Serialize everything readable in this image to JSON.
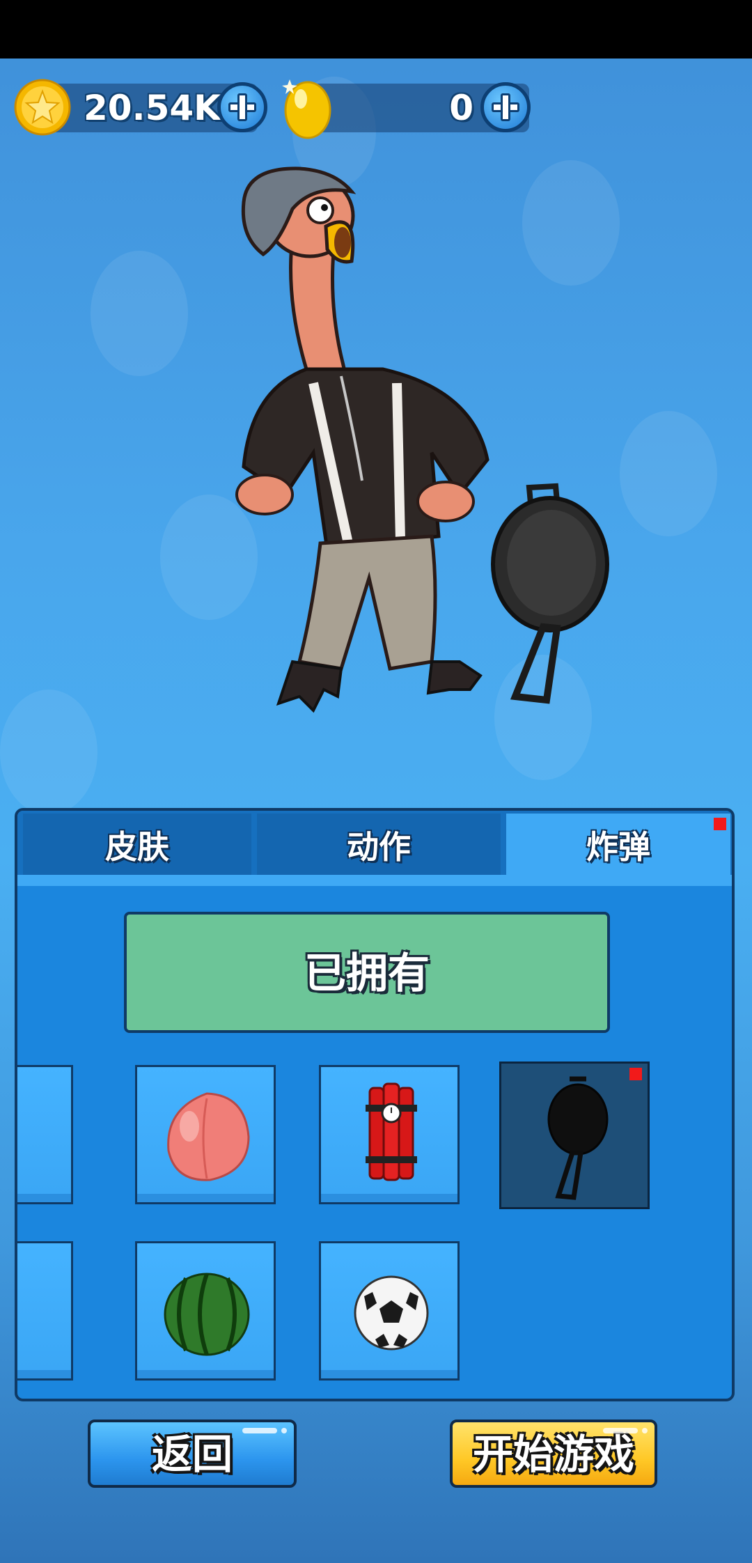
{
  "currency": {
    "stars": "20.54K",
    "eggs": "0"
  },
  "tabs": [
    {
      "label": "皮肤",
      "active": false
    },
    {
      "label": "动作",
      "active": false
    },
    {
      "label": "炸弹",
      "active": true
    }
  ],
  "status": {
    "owned_label": "已拥有"
  },
  "items": [
    {
      "icon": "peach-icon",
      "selected": false
    },
    {
      "icon": "dynamite-icon",
      "selected": false
    },
    {
      "icon": "frying-pan-icon",
      "selected": true
    },
    {
      "icon": "watermelon-icon",
      "selected": false
    },
    {
      "icon": "soccer-ball-icon",
      "selected": false
    }
  ],
  "buttons": {
    "back": "返回",
    "start": "开始游戏"
  },
  "colors": {
    "accent_blue": "#3fa9f5",
    "owned_green": "#6cc598",
    "start_yellow": "#ffc826",
    "notify_red": "#f21a1a"
  }
}
